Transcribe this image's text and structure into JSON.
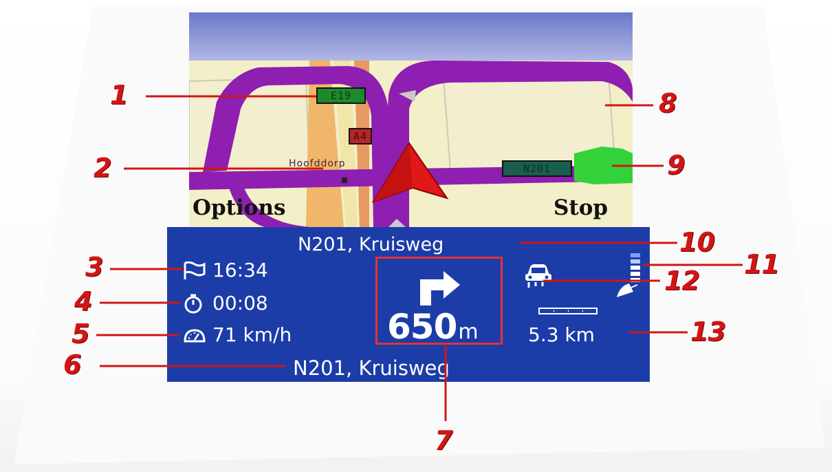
{
  "softkeys": {
    "left": "Options",
    "right": "Stop"
  },
  "map": {
    "signs": {
      "e19": "E19",
      "a4": "A4",
      "n201": "N201"
    },
    "town": "Hoofddorp"
  },
  "panel": {
    "street_top": "N201, Kruisweg",
    "street_bottom": "N201, Kruisweg",
    "eta": "16:34",
    "travel_time": "00:08",
    "speed": "71 km/h",
    "turn": {
      "distance": "650",
      "unit": "m",
      "direction": "right"
    },
    "remaining": "5.3 km",
    "icons": [
      "flag-icon",
      "stopwatch-icon",
      "speedometer-icon",
      "turn-right-arrow-icon",
      "car-icon",
      "gps-signal-icon"
    ]
  },
  "callouts": [
    "1",
    "2",
    "3",
    "4",
    "5",
    "6",
    "7",
    "8",
    "9",
    "10",
    "11",
    "12",
    "13"
  ],
  "colors": {
    "panel": "#1c3da8",
    "route": "#8e1fb0",
    "arrow": "#e01818",
    "callout": "#d11515"
  }
}
